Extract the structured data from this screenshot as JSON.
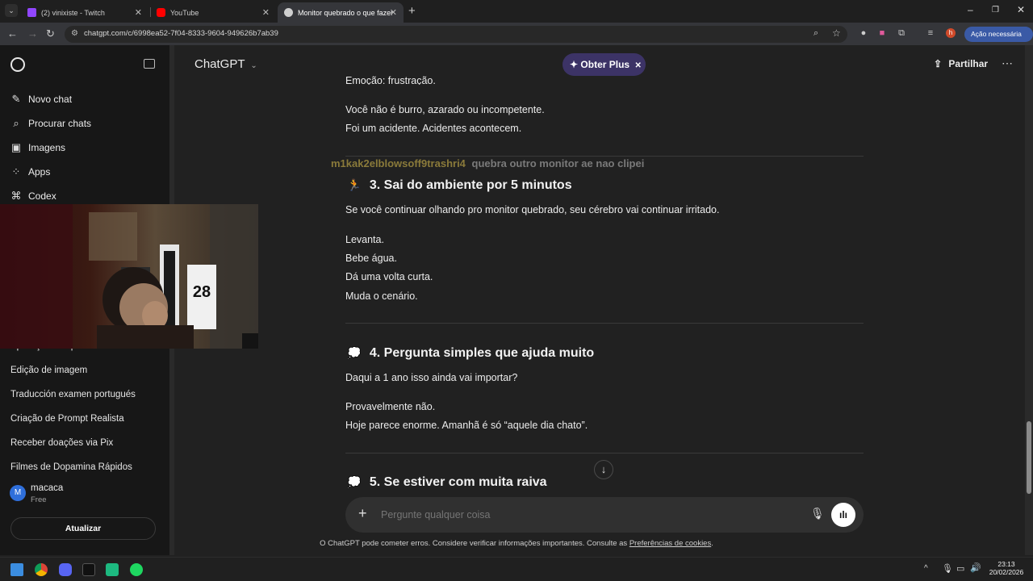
{
  "browser": {
    "tabs": [
      {
        "title": "(2) vinixiste - Twitch",
        "active": false,
        "color": "#9146ff"
      },
      {
        "title": "YouTube",
        "active": false,
        "color": "#ff0000"
      },
      {
        "title": "Monitor quebrado o que fazer",
        "active": true,
        "color": "#cfcfcf"
      }
    ],
    "url": "chatgpt.com/c/6998ea52-7f04-8333-9604-949626b7ab39",
    "profile_initial": "h",
    "action_label": "Ação necessária"
  },
  "sidebar": {
    "primary_items": [
      {
        "label": "Novo chat",
        "icon": "edit-icon"
      },
      {
        "label": "Procurar chats",
        "icon": "search-icon"
      },
      {
        "label": "Imagens",
        "icon": "images-icon"
      },
      {
        "label": "Apps",
        "icon": "apps-icon"
      },
      {
        "label": "Codex",
        "icon": "codex-icon"
      }
    ],
    "history": [
      "Aplicação comportamento",
      "Edição de imagem",
      "Traducción examen portugués",
      "Criação de Prompt Realista",
      "Receber doações via Pix",
      "Filmes de Dopamina Rápidos"
    ],
    "user": {
      "initial": "M",
      "name": "macaca",
      "plan": "Free"
    },
    "upgrade_label": "Atualizar"
  },
  "webcam": {
    "jersey_number": "28"
  },
  "header": {
    "model": "ChatGPT",
    "plus_label": "Obter Plus",
    "share_label": "Partilhar"
  },
  "conversation": {
    "cut_line": "Emoção: frustração.",
    "para1": [
      "Você não é burro, azarado ou incompetente.",
      "Foi um acidente. Acidentes acontecem."
    ],
    "overlay_chat": {
      "user": "m1kak2elblowsoff9trashri4",
      "message": "quebra outro monitor ae nao clipei",
      "user_color": "#8a7a3a"
    },
    "section3": {
      "emoji": "🏃",
      "title": "3. Sai do ambiente por 5 minutos"
    },
    "s3_intro": "Se você continuar olhando pro monitor quebrado, seu cérebro vai continuar irritado.",
    "s3_steps": [
      "Levanta.",
      "Bebe água.",
      "Dá uma volta curta.",
      "Muda o cenário."
    ],
    "section4": {
      "emoji": "💭",
      "title": "4. Pergunta simples que ajuda muito"
    },
    "s4_q": "Daqui a 1 ano isso ainda vai importar?",
    "s4_a": [
      "Provavelmente não.",
      "Hoje parece enorme. Amanhã é só “aquele dia chato”."
    ],
    "section5": {
      "emoji": "💭",
      "title": "5. Se estiver com muita raiva"
    }
  },
  "composer": {
    "placeholder": "Pergunte qualquer coisa"
  },
  "footer": {
    "text": "O ChatGPT pode cometer erros. Considere verificar informações importantes. Consulte as",
    "link": "Preferências de cookies",
    "end": "."
  },
  "taskbar": {
    "time": "23:13",
    "date": "20/02/2026"
  }
}
